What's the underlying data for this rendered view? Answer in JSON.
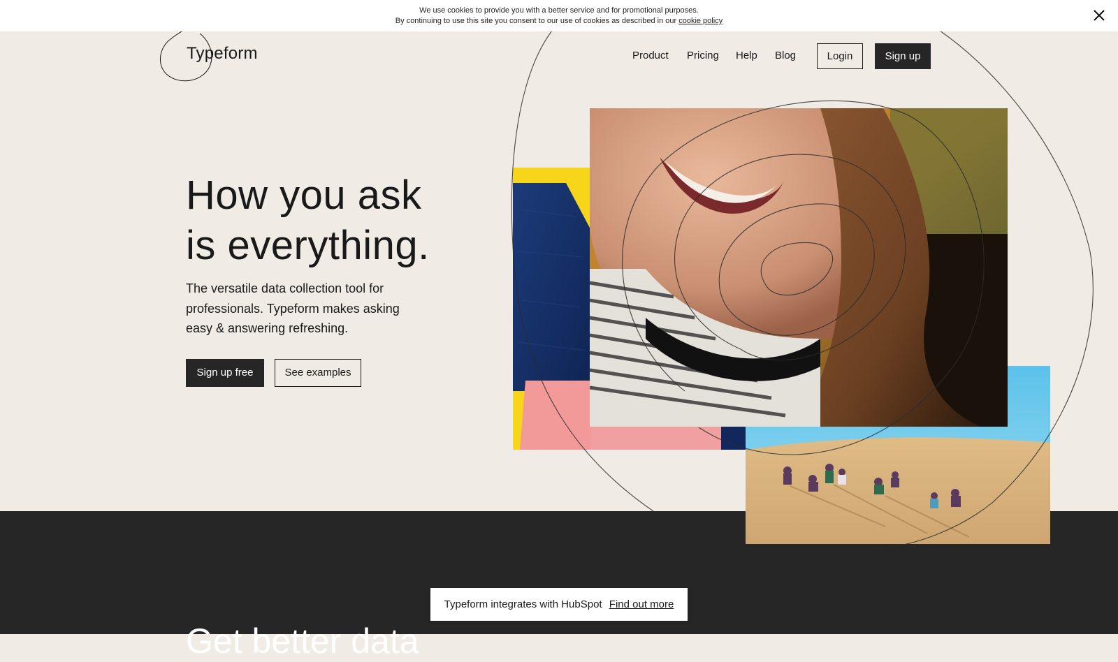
{
  "cookie_bar": {
    "line1": "We use cookies to provide you with a better service and for promotional purposes.",
    "line2_prefix": "By continuing to use this site you consent to our use of cookies as described in our",
    "link_label": "cookie policy",
    "close_icon": "close-icon"
  },
  "header": {
    "logo": "Typeform",
    "nav": [
      "Product",
      "Pricing",
      "Help",
      "Blog"
    ],
    "login_label": "Login",
    "signup_label": "Sign up"
  },
  "hero": {
    "title_line1": "How you ask",
    "title_line2": "is everything.",
    "subtitle": "The versatile data collection tool for professionals. Typeform makes asking easy & answering refreshing.",
    "primary_cta": "Sign up free",
    "secondary_cta": "See examples"
  },
  "images": {
    "abstract": "abstract-painting-image",
    "portrait": "smiling-woman-photo",
    "desert": "desert-group-photo"
  },
  "next_section": {
    "heading": "Get better data"
  },
  "toast": {
    "text": "Typeform integrates with HubSpot",
    "link_label": "Find out more"
  },
  "colors": {
    "page_background": "#f0ebe4",
    "dark": "#262627",
    "text": "#191919",
    "white": "#ffffff"
  }
}
